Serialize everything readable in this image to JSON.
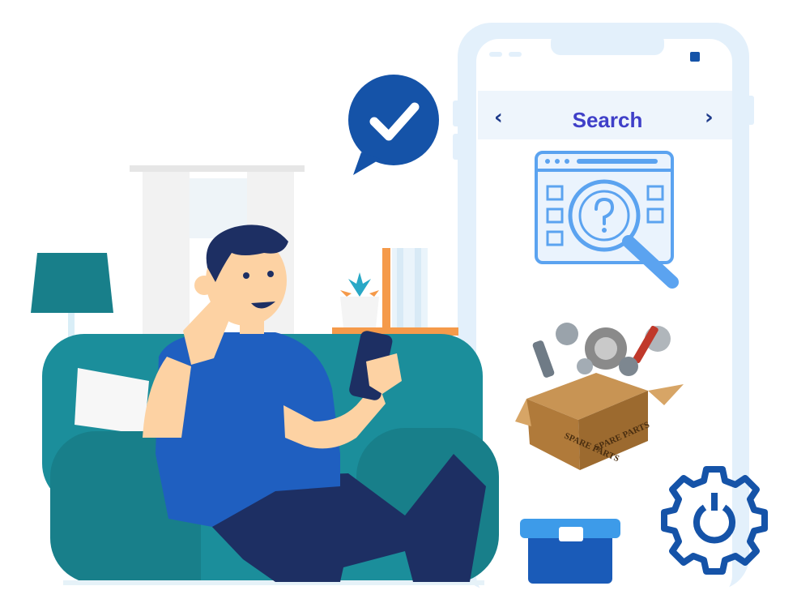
{
  "phone": {
    "title": "Search",
    "prev_icon": "chevron-left-icon",
    "next_icon": "chevron-right-icon"
  },
  "box": {
    "label": "SPARE PARTS"
  },
  "colors": {
    "phone_frame": "#e3f0fb",
    "phone_screen": "#ffffff",
    "title": "#3f3fc8",
    "checkmark_bubble": "#1553a8",
    "sofa": "#187f8a",
    "shirt": "#1f5fc0",
    "pants": "#1d2f63",
    "search_illustration": "#5ba3f0",
    "gear_icon": "#1553a8",
    "toolbox": "#1a5bb8",
    "shelf": "#f59a4a"
  },
  "icons": [
    "checkmark-bubble-icon",
    "search-window-icon",
    "settings-gear-icon",
    "toolbox-icon",
    "spare-parts-box"
  ]
}
